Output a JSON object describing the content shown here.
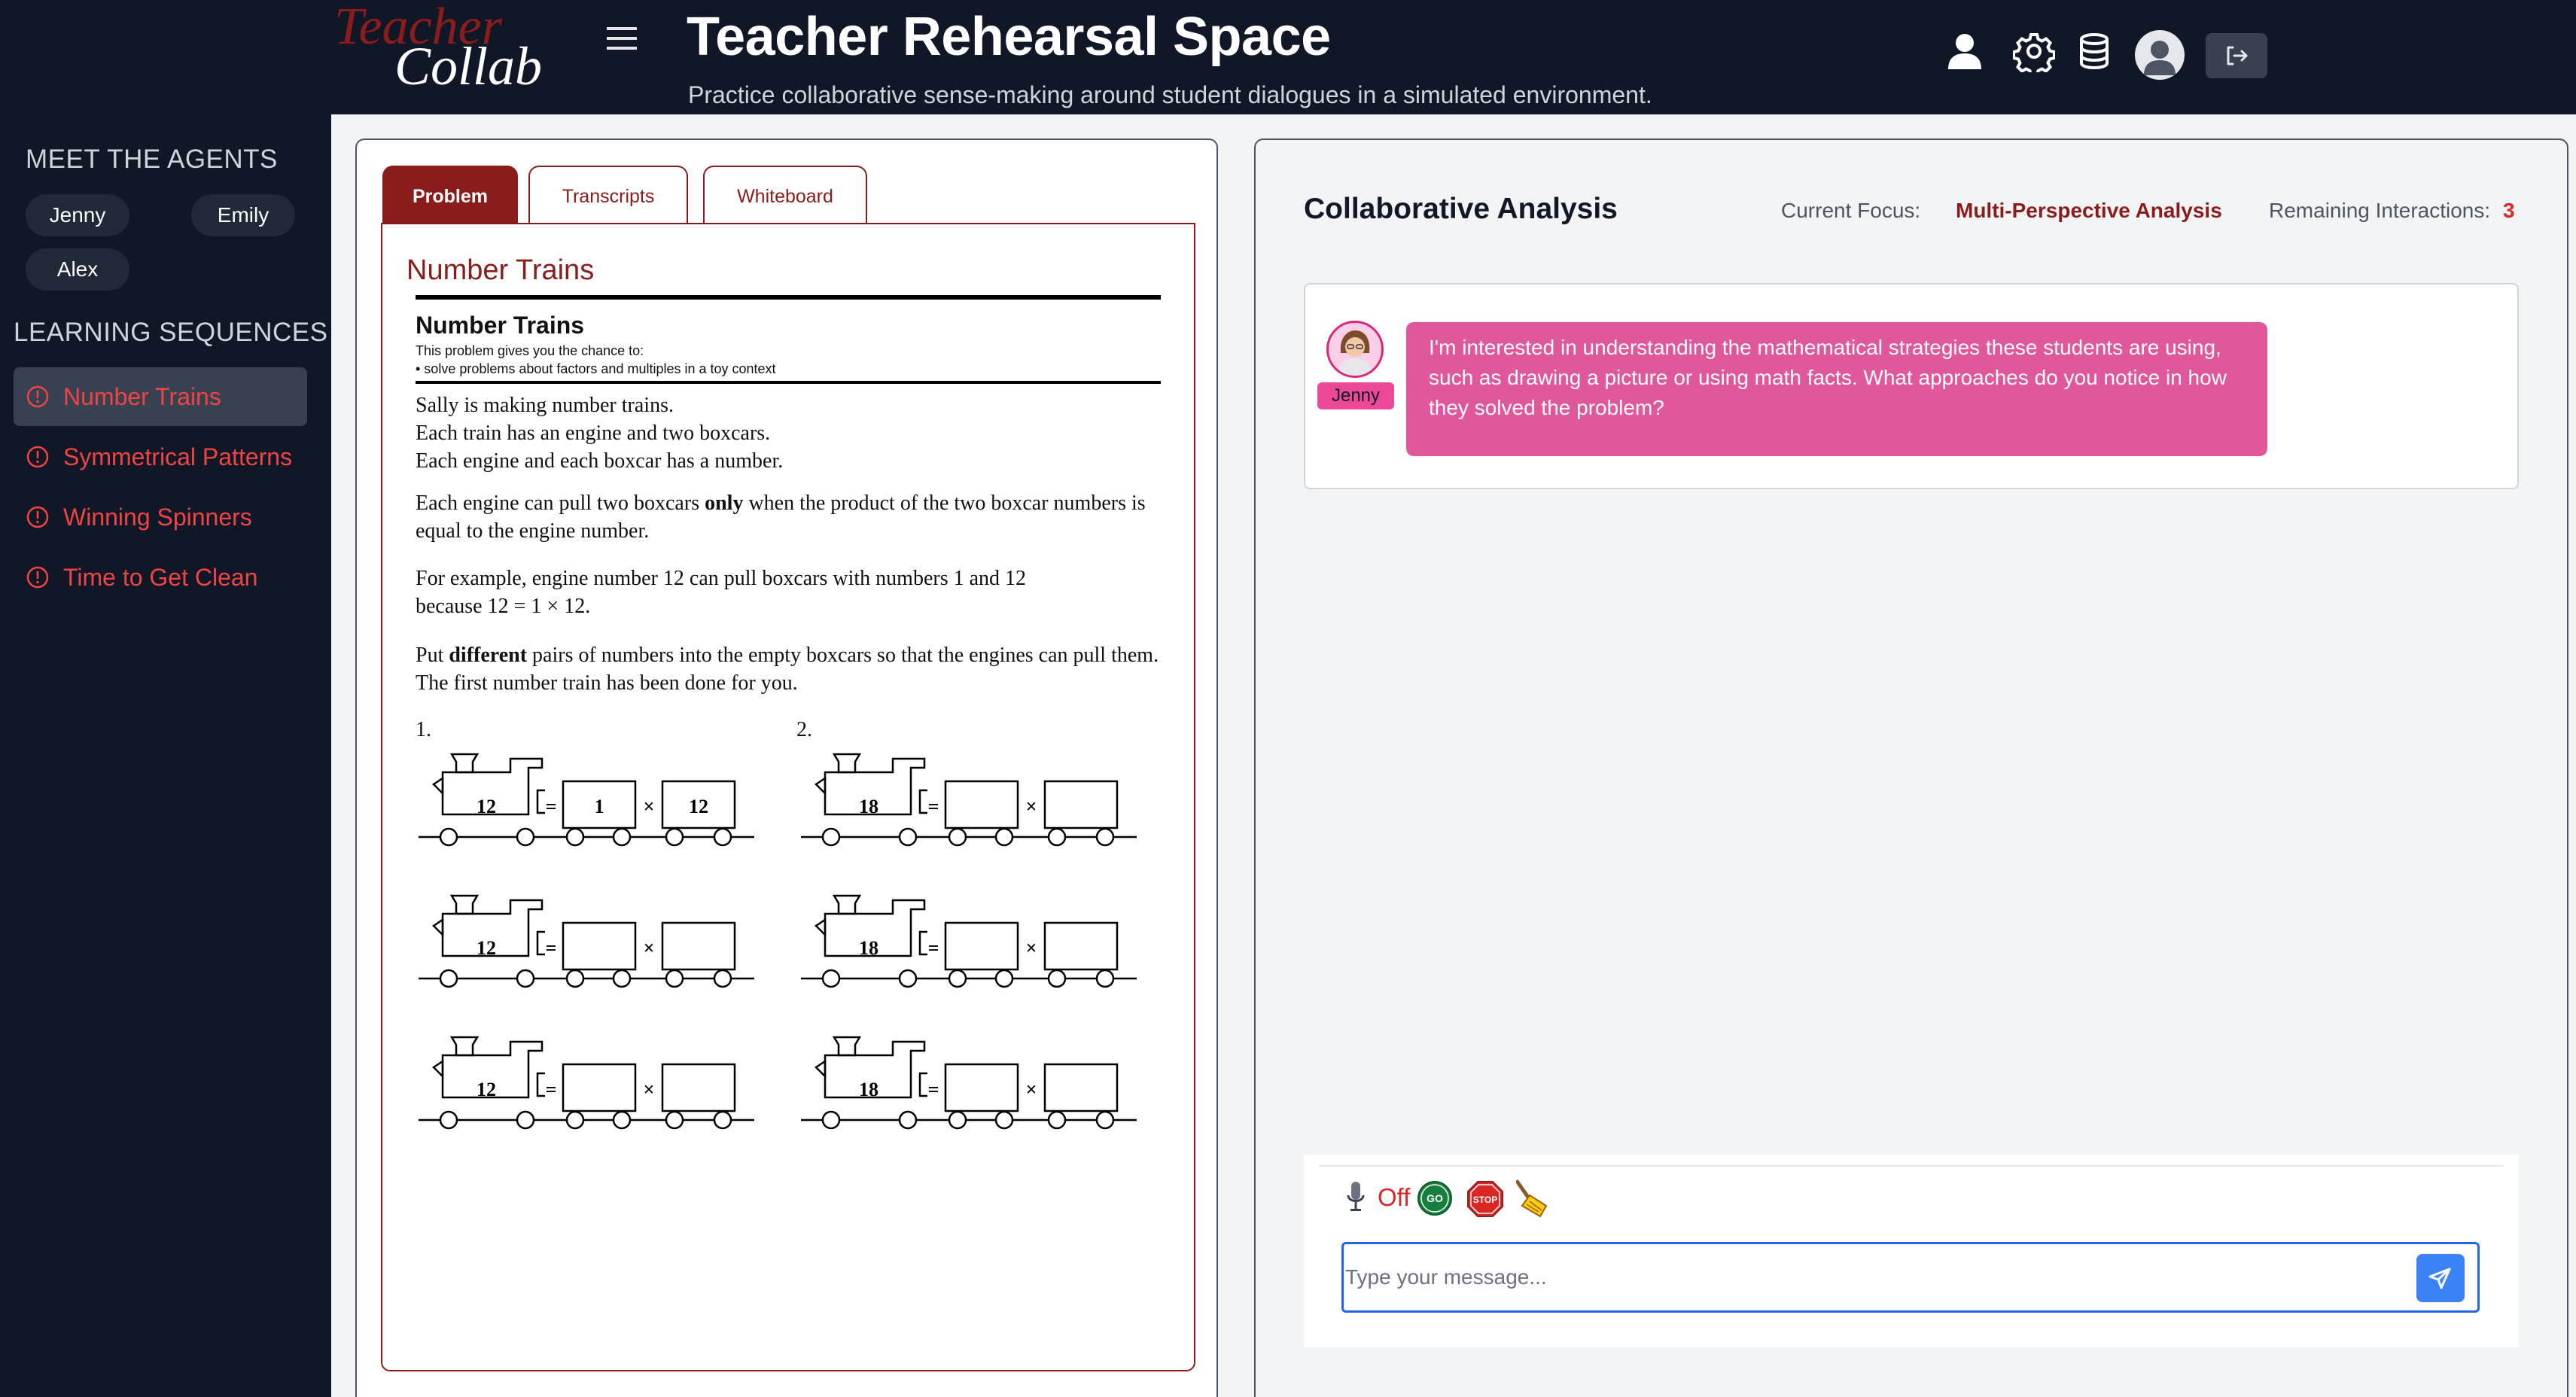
{
  "header": {
    "logo_text_top": "Teacher",
    "logo_text_bottom": "Collab",
    "title": "Teacher Rehearsal Space",
    "subtitle": "Practice collaborative sense-making around student dialogues in a simulated environment.",
    "icons": [
      "menu-icon",
      "user-icon",
      "gear-icon",
      "database-icon",
      "profile-avatar",
      "logout-icon"
    ]
  },
  "sidebar": {
    "agents_heading": "MEET THE AGENTS",
    "agents": [
      "Jenny",
      "Emily",
      "Alex"
    ],
    "sequences_heading": "LEARNING SEQUENCES",
    "sequences": [
      {
        "label": "Number Trains",
        "active": true
      },
      {
        "label": "Symmetrical Patterns",
        "active": false
      },
      {
        "label": "Winning Spinners",
        "active": false
      },
      {
        "label": "Time to Get Clean",
        "active": false
      }
    ]
  },
  "problem_panel": {
    "tabs": [
      "Problem",
      "Transcripts",
      "Whiteboard"
    ],
    "active_tab": "Problem",
    "title": "Number Trains",
    "worksheet": {
      "title": "Number Trains",
      "intro_line1": "This problem gives you the chance to:",
      "intro_line2": "• solve problems about factors and multiples in a toy context",
      "para1": [
        "Sally is making number trains.",
        "Each train has an engine and two boxcars.",
        "Each engine and each boxcar has a number."
      ],
      "para2_a": "Each engine can pull two boxcars ",
      "para2_b": "only",
      "para2_c": " when the product of the two boxcar numbers is equal to the engine number.",
      "para3": "For example, engine number 12 can pull boxcars with numbers 1 and 12 because 12 = 1 × 12.",
      "para4_a": "Put ",
      "para4_b": "different",
      "para4_c": " pairs of numbers into the empty boxcars so that the engines can pull them. The first number train has been done for you.",
      "q1": "1.",
      "q2": "2.",
      "trains_left": [
        {
          "engine": "12",
          "box1": "1",
          "box2": "12"
        },
        {
          "engine": "12",
          "box1": "",
          "box2": ""
        },
        {
          "engine": "12",
          "box1": "",
          "box2": ""
        }
      ],
      "trains_right": [
        {
          "engine": "18",
          "box1": "",
          "box2": ""
        },
        {
          "engine": "18",
          "box1": "",
          "box2": ""
        },
        {
          "engine": "18",
          "box1": "",
          "box2": ""
        }
      ],
      "equals": "=",
      "times": "×"
    }
  },
  "analysis_panel": {
    "title": "Collaborative Analysis",
    "current_focus_label": "Current Focus:",
    "current_focus_value": "Multi-Perspective Analysis",
    "remaining_label": "Remaining Interactions:",
    "remaining_value": "3",
    "messages": [
      {
        "agent": "Jenny",
        "text": "I'm interested in understanding the mathematical strategies these students are using, such as drawing a picture or using math facts. What approaches do you notice in how they solved the problem?"
      }
    ],
    "controls": {
      "mic_status": "Off",
      "go_label": "GO",
      "stop_label": "STOP"
    },
    "input_placeholder": "Type your message...",
    "input_value": ""
  },
  "colors": {
    "dark_bg": "#101827",
    "accent_red": "#8b1c1c",
    "sidebar_link": "#ef4444",
    "jenny_pink": "#e0579b",
    "send_blue": "#3b82f6"
  }
}
